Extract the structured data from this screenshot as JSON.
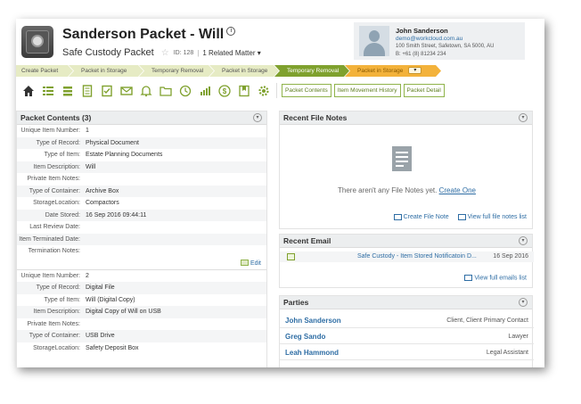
{
  "header": {
    "title": "Sanderson Packet - Will",
    "info_glyph": "i",
    "subtitle": "Safe Custody Packet",
    "id_label": "ID: 128",
    "related": "1 Related Matter"
  },
  "contact": {
    "name": "John Sanderson",
    "email": "demo@workcloud.com.au",
    "address": "100 Smith Street, Safetown, SA 5000, AU",
    "phone": "B: +61 (8) 81234 234"
  },
  "process_steps": [
    {
      "label": "Create Packet",
      "state": "done"
    },
    {
      "label": "Packet in Storage",
      "state": "done"
    },
    {
      "label": "Temporary Removal",
      "state": "done"
    },
    {
      "label": "Packet in Storage",
      "state": "done"
    },
    {
      "label": "Temporary Removal",
      "state": "active"
    },
    {
      "label": "Packet in Storage",
      "state": "current"
    }
  ],
  "toolbar": {
    "icons": [
      "home-icon",
      "tasks-icon",
      "stack-icon",
      "document-icon",
      "checklist-icon",
      "email-icon",
      "bell-icon",
      "folder-icon",
      "clock-icon",
      "chart-icon",
      "dollar-icon",
      "bookmark-icon",
      "cog-person-icon"
    ],
    "buttons": [
      "Packet Contents",
      "Item Movement History",
      "Packet Detail"
    ]
  },
  "packet_contents": {
    "title": "Packet Contents (3)",
    "item1": {
      "rows": [
        {
          "k": "Unique Item Number:",
          "v": "1"
        },
        {
          "k": "Type of Record:",
          "v": "Physical Document"
        },
        {
          "k": "Type of Item:",
          "v": "Estate Planning Documents"
        },
        {
          "k": "Item Description:",
          "v": "Will"
        },
        {
          "k": "Private Item Notes:",
          "v": ""
        },
        {
          "k": "Type of Container:",
          "v": "Archive Box"
        },
        {
          "k": "StorageLocation:",
          "v": "Compactors"
        },
        {
          "k": "Date Stored:",
          "v": "16 Sep 2016 09:44:11"
        },
        {
          "k": "Last Review Date:",
          "v": ""
        },
        {
          "k": "Item Terminated Date:",
          "v": ""
        },
        {
          "k": "Termination Notes:",
          "v": ""
        }
      ],
      "edit_label": "Edit"
    },
    "item2": {
      "rows": [
        {
          "k": "Unique Item Number:",
          "v": "2"
        },
        {
          "k": "Type of Record:",
          "v": "Digital File"
        },
        {
          "k": "Type of Item:",
          "v": "Will (Digital Copy)"
        },
        {
          "k": "Item Description:",
          "v": "Digital Copy of Will on USB"
        },
        {
          "k": "Private Item Notes:",
          "v": ""
        },
        {
          "k": "Type of Container:",
          "v": "USB Drive"
        },
        {
          "k": "StorageLocation:",
          "v": "Safety Deposit Box"
        }
      ]
    }
  },
  "file_notes": {
    "title": "Recent File Notes",
    "empty_text": "There aren't any File Notes yet.",
    "create_one": "Create One",
    "create_link": "Create File Note",
    "view_link": "View full file notes list"
  },
  "recent_email": {
    "title": "Recent Email",
    "subject": "Safe Custody - Item Stored Notificatoin  D...",
    "date": "16 Sep 2016",
    "view_link": "View full emails list"
  },
  "parties": {
    "title": "Parties",
    "list": [
      {
        "name": "John Sanderson",
        "role": "Client, Client Primary Contact"
      },
      {
        "name": "Greg Sando",
        "role": "Lawyer"
      },
      {
        "name": "Leah Hammond",
        "role": "Legal Assistant"
      }
    ]
  },
  "colors": {
    "accent_green": "#7fa12e",
    "current_orange": "#f3b23b",
    "link_blue": "#2e6da4"
  }
}
